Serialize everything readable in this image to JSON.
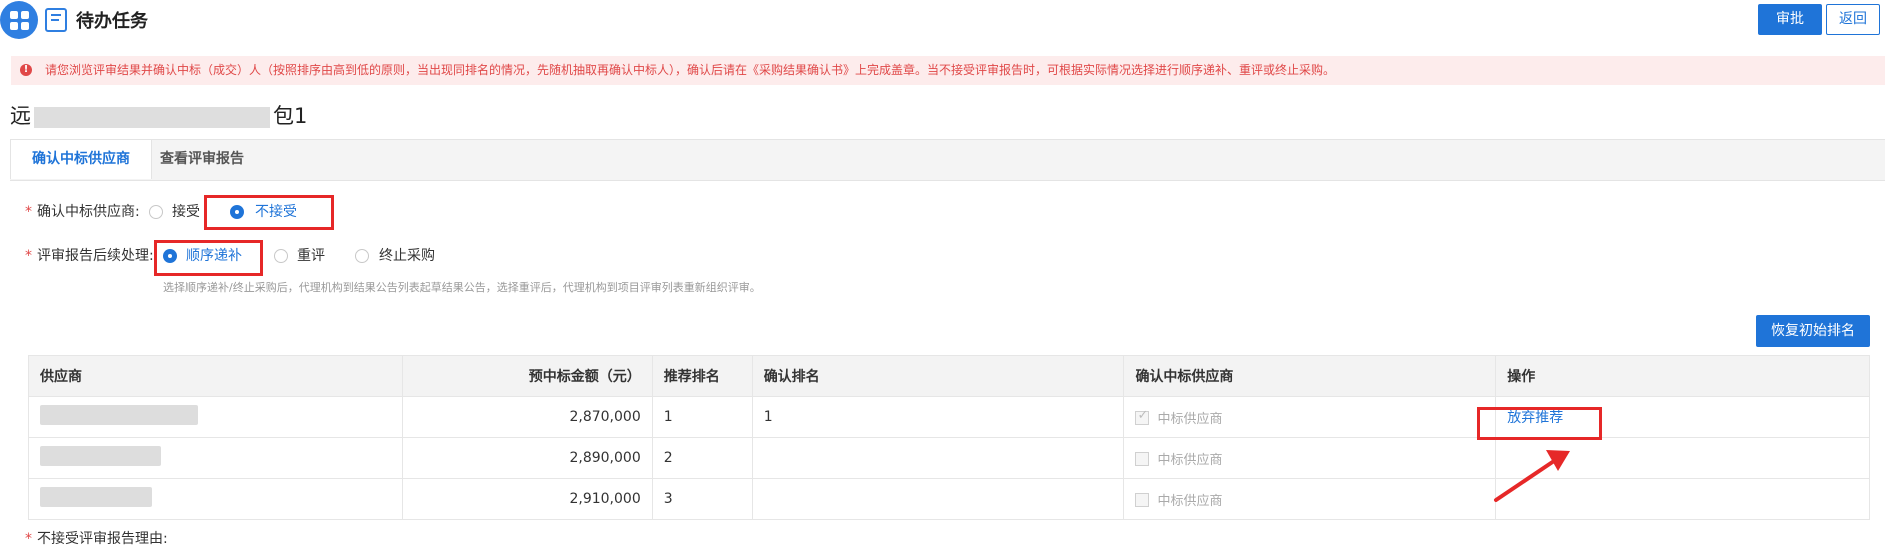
{
  "header": {
    "title": "待办任务",
    "approve_label": "审批",
    "back_label": "返回"
  },
  "alert": {
    "text": "请您浏览评审结果并确认中标（成交）人（按照排序由高到低的原则，当出现同排名的情况，先随机抽取再确认中标人），确认后请在《采购结果确认书》上完成盖章。当不接受评审报告时，可根据实际情况选择进行顺序递补、重评或终止采购。"
  },
  "project": {
    "prefix": "远",
    "suffix": "包1"
  },
  "tabs": [
    {
      "label": "确认中标供应商"
    },
    {
      "label": "查看评审报告"
    }
  ],
  "form": {
    "supplier_label": "确认中标供应商:",
    "accept_label": "接受",
    "reject_label": "不接受",
    "followup_label": "评审报告后续处理:",
    "options": [
      "顺序递补",
      "重评",
      "终止采购"
    ],
    "hint": "选择顺序递补/终止采购后，代理机构到结果公告列表起草结果公告，选择重评后，代理机构到项目评审列表重新组织评审。"
  },
  "restore_label": "恢复初始排名",
  "table": {
    "headers": [
      "供应商",
      "预中标金额（元）",
      "推荐排名",
      "确认排名",
      "确认中标供应商",
      "操作"
    ],
    "rows": [
      {
        "amount": "2,870,000",
        "recommended": "1",
        "confirmed": "1",
        "winner_label": "中标供应商",
        "checked": true,
        "action": "放弃推荐"
      },
      {
        "amount": "2,890,000",
        "recommended": "2",
        "confirmed": "",
        "winner_label": "中标供应商",
        "checked": false,
        "action": ""
      },
      {
        "amount": "2,910,000",
        "recommended": "3",
        "confirmed": "",
        "winner_label": "中标供应商",
        "checked": false,
        "action": ""
      }
    ]
  },
  "reason_label": "不接受评审报告理由:",
  "colors": {
    "primary": "#1f74d8",
    "alert_background": "#fdecec",
    "alert_text": "#e04848",
    "annotation": "#e62828"
  }
}
